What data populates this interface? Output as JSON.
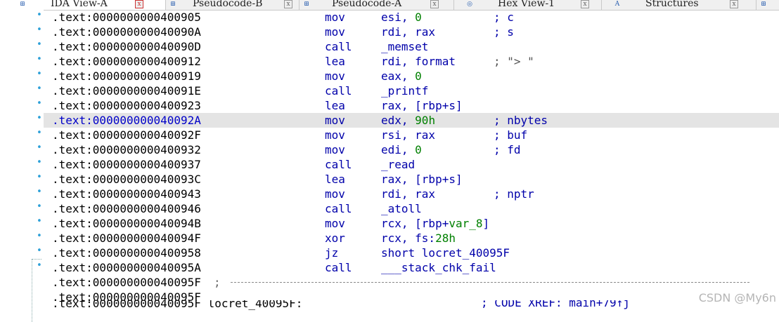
{
  "tabs": [
    {
      "label": "IDA View-A",
      "icon": "⊞",
      "active": true
    },
    {
      "label": "Pseudocode-B",
      "icon": "⊞",
      "active": false
    },
    {
      "label": "Pseudocode-A",
      "icon": "⊞",
      "active": false
    },
    {
      "label": "Hex View-1",
      "icon": "◎",
      "active": false
    },
    {
      "label": "Structures",
      "icon": "A",
      "active": false
    },
    {
      "label": "",
      "icon": "⊞",
      "active": false
    }
  ],
  "close_glyph": "x",
  "listing": [
    {
      "addr": ".text:0000000000400905",
      "mnem": "mov",
      "op1": "esi, ",
      "num": "0",
      "op2": "",
      "cmt": "; c"
    },
    {
      "addr": ".text:000000000040090A",
      "mnem": "mov",
      "op1": "rdi, rax",
      "num": "",
      "op2": "",
      "cmt": "; s"
    },
    {
      "addr": ".text:000000000040090D",
      "mnem": "call",
      "op1": "_memset",
      "num": "",
      "op2": "",
      "cmt": ""
    },
    {
      "addr": ".text:0000000000400912",
      "mnem": "lea",
      "op1": "rdi, format",
      "num": "",
      "op2": "",
      "cmt": "; \"> \""
    },
    {
      "addr": ".text:0000000000400919",
      "mnem": "mov",
      "op1": "eax, ",
      "num": "0",
      "op2": "",
      "cmt": ""
    },
    {
      "addr": ".text:000000000040091E",
      "mnem": "call",
      "op1": "_printf",
      "num": "",
      "op2": "",
      "cmt": ""
    },
    {
      "addr": ".text:0000000000400923",
      "mnem": "lea",
      "op1": "rax, [rbp+s]",
      "num": "",
      "op2": "",
      "cmt": ""
    },
    {
      "addr": ".text:000000000040092A",
      "mnem": "mov",
      "op1": "edx, ",
      "num": "90h",
      "op2": "",
      "cmt": "; nbytes"
    },
    {
      "addr": ".text:000000000040092F",
      "mnem": "mov",
      "op1": "rsi, rax",
      "num": "",
      "op2": "",
      "cmt": "; buf"
    },
    {
      "addr": ".text:0000000000400932",
      "mnem": "mov",
      "op1": "edi, ",
      "num": "0",
      "op2": "",
      "cmt": "; fd"
    },
    {
      "addr": ".text:0000000000400937",
      "mnem": "call",
      "op1": "_read",
      "num": "",
      "op2": "",
      "cmt": ""
    },
    {
      "addr": ".text:000000000040093C",
      "mnem": "lea",
      "op1": "rax, [rbp+s]",
      "num": "",
      "op2": "",
      "cmt": ""
    },
    {
      "addr": ".text:0000000000400943",
      "mnem": "mov",
      "op1": "rdi, rax",
      "num": "",
      "op2": "",
      "cmt": "; nptr"
    },
    {
      "addr": ".text:0000000000400946",
      "mnem": "call",
      "op1": "_atoll",
      "num": "",
      "op2": "",
      "cmt": ""
    },
    {
      "addr": ".text:000000000040094B",
      "mnem": "mov",
      "op1": "rcx, [rbp+",
      "num": "var_8",
      "op2": "]",
      "cmt": ""
    },
    {
      "addr": ".text:000000000040094F",
      "mnem": "xor",
      "op1": "rcx, fs:",
      "num": "28h",
      "op2": "",
      "cmt": ""
    },
    {
      "addr": ".text:0000000000400958",
      "mnem": "jz",
      "op1": "short locret_40095F",
      "num": "",
      "op2": "",
      "cmt": ""
    },
    {
      "addr": ".text:000000000040095A",
      "mnem": "call",
      "op1": "___stack_chk_fail",
      "num": "",
      "op2": "",
      "cmt": ""
    },
    {
      "addr": ".text:000000000040095F",
      "mnem": "",
      "op1": "",
      "num": "",
      "op2": "",
      "cmt": ""
    },
    {
      "addr": ".text:000000000040095F",
      "mnem": "",
      "op1": "",
      "num": "",
      "op2": "",
      "cmt": ""
    }
  ],
  "separator_semicolon": ";",
  "selected_addr": ".text:000000000040092A",
  "partial_row": {
    "text": ".text:000000000040095F locret_40095F:",
    "comment": "; CODE XREF: main+79↑j"
  },
  "watermark": "CSDN @My6n"
}
